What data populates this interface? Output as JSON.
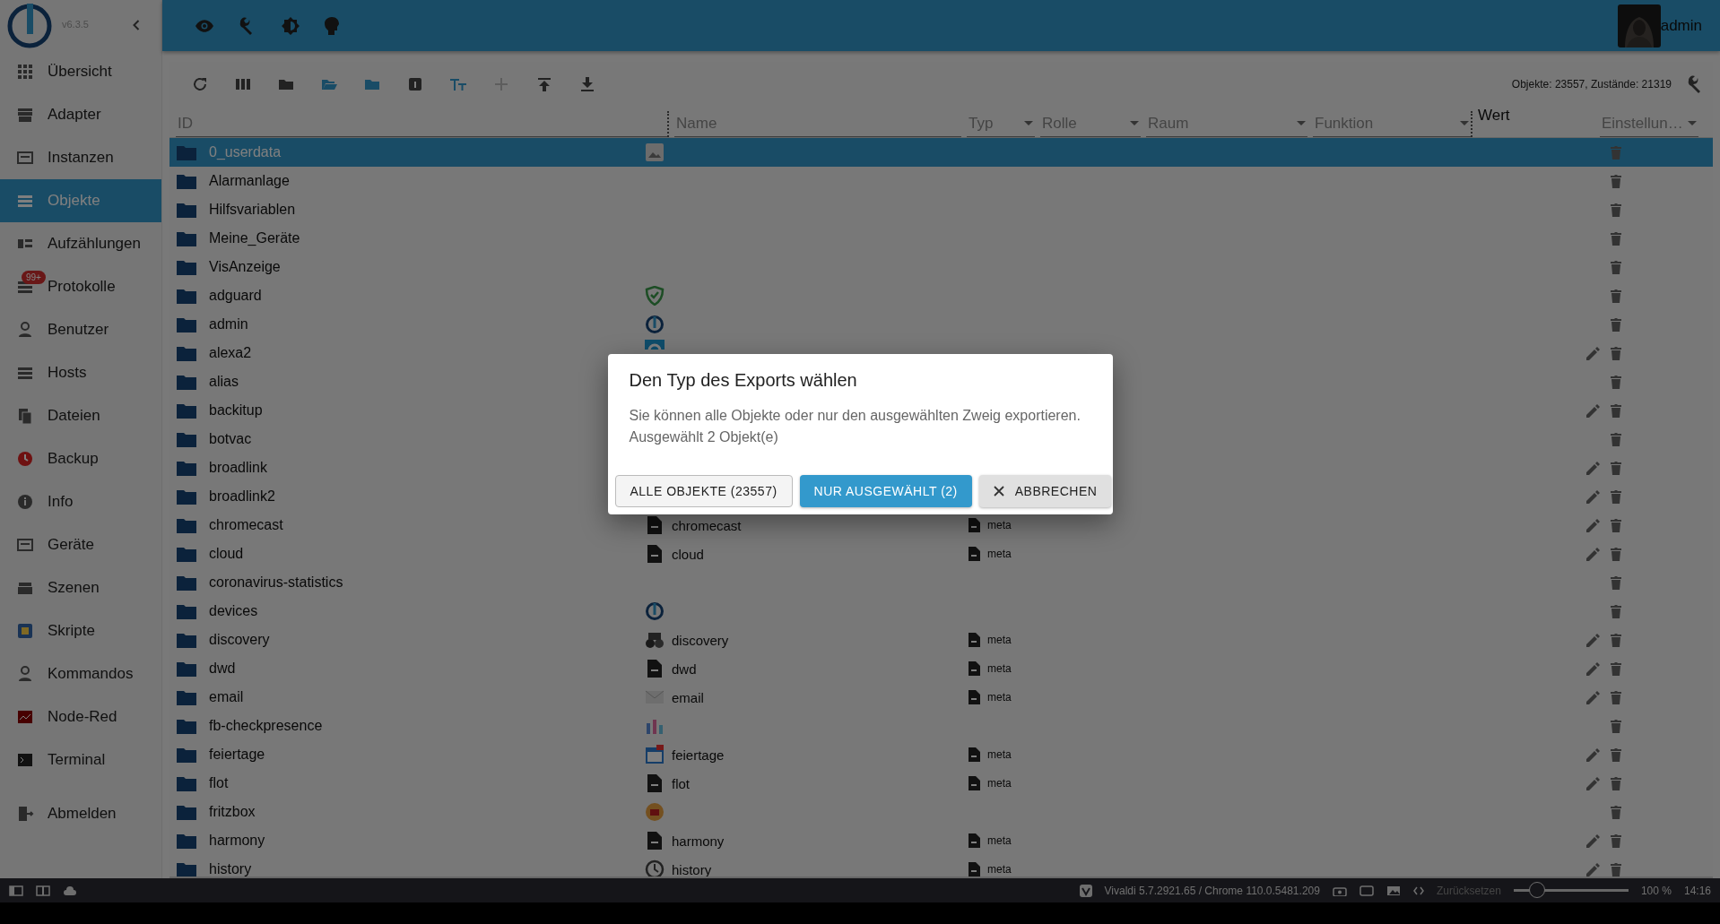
{
  "sidebar": {
    "version": "v6.3.5",
    "items": [
      {
        "label": "Übersicht",
        "selected": false
      },
      {
        "label": "Adapter",
        "selected": false
      },
      {
        "label": "Instanzen",
        "selected": false
      },
      {
        "label": "Objekte",
        "selected": true
      },
      {
        "label": "Aufzählungen",
        "selected": false
      },
      {
        "label": "Protokolle",
        "selected": false,
        "badge": "99+"
      },
      {
        "label": "Benutzer",
        "selected": false
      },
      {
        "label": "Hosts",
        "selected": false
      },
      {
        "label": "Dateien",
        "selected": false
      },
      {
        "label": "Backup",
        "selected": false
      },
      {
        "label": "Info",
        "selected": false
      },
      {
        "label": "Geräte",
        "selected": false
      },
      {
        "label": "Szenen",
        "selected": false
      },
      {
        "label": "Skripte",
        "selected": false
      },
      {
        "label": "Kommandos",
        "selected": false
      },
      {
        "label": "Node-Red",
        "selected": false
      },
      {
        "label": "Terminal",
        "selected": false
      },
      {
        "label": "Abmelden",
        "selected": false
      }
    ]
  },
  "header": {
    "user": "admin"
  },
  "stats": "Objekte: 23557, Zustände: 21319",
  "columns": [
    {
      "kind": "text",
      "placeholder": "ID"
    },
    {
      "kind": "text",
      "placeholder": "Name"
    },
    {
      "kind": "select",
      "placeholder": "Typ"
    },
    {
      "kind": "select",
      "placeholder": "Rolle"
    },
    {
      "kind": "select",
      "placeholder": "Raum"
    },
    {
      "kind": "select",
      "placeholder": "Funktion"
    },
    {
      "kind": "label",
      "label": "Wert"
    },
    {
      "kind": "select",
      "placeholder": "Einstellun…"
    }
  ],
  "rows": [
    {
      "id": "0_userdata",
      "selected": true,
      "editable": false
    },
    {
      "id": "Alarmanlage",
      "selected": false,
      "editable": false
    },
    {
      "id": "Hilfsvariablen",
      "selected": false,
      "editable": false
    },
    {
      "id": "Meine_Geräte",
      "selected": false,
      "editable": false
    },
    {
      "id": "VisAnzeige",
      "selected": false,
      "editable": false
    },
    {
      "id": "adguard",
      "selected": false,
      "editable": false
    },
    {
      "id": "admin",
      "selected": false,
      "editable": false
    },
    {
      "id": "alexa2",
      "selected": false,
      "editable": true
    },
    {
      "id": "alias",
      "selected": false,
      "editable": false
    },
    {
      "id": "backitup",
      "selected": false,
      "editable": true
    },
    {
      "id": "botvac",
      "selected": false,
      "editable": false
    },
    {
      "id": "broadlink",
      "selected": false,
      "editable": true
    },
    {
      "id": "broadlink2",
      "selected": false,
      "editable": true
    },
    {
      "id": "chromecast",
      "name": "chromecast",
      "type": "meta",
      "selected": false,
      "editable": true
    },
    {
      "id": "cloud",
      "name": "cloud",
      "type": "meta",
      "selected": false,
      "editable": true
    },
    {
      "id": "coronavirus-statistics",
      "selected": false,
      "editable": false
    },
    {
      "id": "devices",
      "selected": false,
      "editable": false
    },
    {
      "id": "discovery",
      "name": "discovery",
      "type": "meta",
      "selected": false,
      "editable": true
    },
    {
      "id": "dwd",
      "name": "dwd",
      "type": "meta",
      "selected": false,
      "editable": true
    },
    {
      "id": "email",
      "name": "email",
      "type": "meta",
      "selected": false,
      "editable": true
    },
    {
      "id": "fb-checkpresence",
      "selected": false,
      "editable": false
    },
    {
      "id": "feiertage",
      "name": "feiertage",
      "type": "meta",
      "selected": false,
      "editable": true
    },
    {
      "id": "flot",
      "name": "flot",
      "type": "meta",
      "selected": false,
      "editable": true
    },
    {
      "id": "fritzbox",
      "selected": false,
      "editable": false
    },
    {
      "id": "harmony",
      "name": "harmony",
      "type": "meta",
      "selected": false,
      "editable": true
    },
    {
      "id": "history",
      "name": "history",
      "type": "meta",
      "selected": false,
      "editable": true
    }
  ],
  "dialog": {
    "title": "Den Typ des Exports wählen",
    "text": "Sie können alle Objekte oder nur den ausgewählten Zweig exportieren.",
    "detail": "Ausgewählt 2 Objekt(e)",
    "buttons": [
      {
        "kind": "outlined",
        "label": "ALLE OBJEKTE (23557)"
      },
      {
        "kind": "primary",
        "label": "NUR AUSGEWÄHLT (2)"
      },
      {
        "kind": "cancel",
        "label": "ABBRECHEN"
      }
    ]
  },
  "browser_bar": {
    "version": "Vivaldi 5.7.2921.65 / Chrome 110.0.5481.209",
    "reset": "Zurücksetzen",
    "zoom": {
      "level": 0.2
    },
    "zoom_reading": "100 %",
    "time": "14:16"
  }
}
